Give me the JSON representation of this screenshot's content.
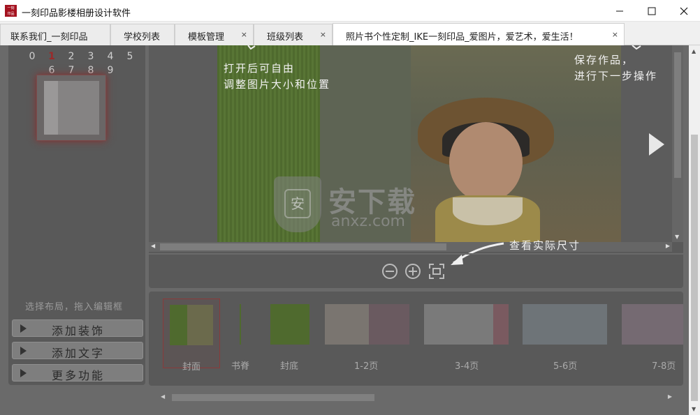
{
  "window": {
    "title": "一刻印品影楼相册设计软件",
    "app_icon_text": "一刻印品"
  },
  "tabs": [
    {
      "label": "联系我们_一刻印品",
      "closable": false
    },
    {
      "label": "学校列表",
      "closable": false
    },
    {
      "label": "模板管理",
      "closable": true
    },
    {
      "label": "班级列表",
      "closable": true
    },
    {
      "label": "照片书个性定制_IKE一刻印品_爱图片，爱艺术，爱生活！",
      "closable": true,
      "active": true
    }
  ],
  "tab_close_glyph": "×",
  "left_panel": {
    "page_numbers_row1": [
      "0",
      "1",
      "2",
      "3",
      "4",
      "5"
    ],
    "page_numbers_row2": [
      "6",
      "7",
      "8",
      "9"
    ],
    "current_page": "1",
    "hint": "选择布局，拖入编辑框",
    "buttons": [
      {
        "label": "添加装饰"
      },
      {
        "label": "添加文字"
      },
      {
        "label": "更多功能"
      }
    ]
  },
  "editor": {
    "note_adjust": "打开后可自由\n调整图片大小和位置",
    "note_save": "保存作品，\n进行下一步操作",
    "note_actual_size": "查看实际尺寸"
  },
  "thumbnails": [
    {
      "label": "封面",
      "selected": true
    },
    {
      "label": "书脊"
    },
    {
      "label": "封底"
    },
    {
      "label": "1-2页"
    },
    {
      "label": "3-4页"
    },
    {
      "label": "5-6页"
    },
    {
      "label": "7-8页"
    }
  ],
  "watermark": {
    "text": "安下载",
    "url": "anxz.com",
    "shield_char": "安"
  },
  "colors": {
    "overlay": "#6a6a6a",
    "panel": "#595959",
    "accent_red": "#a4121f",
    "green_cover": "#587535"
  }
}
